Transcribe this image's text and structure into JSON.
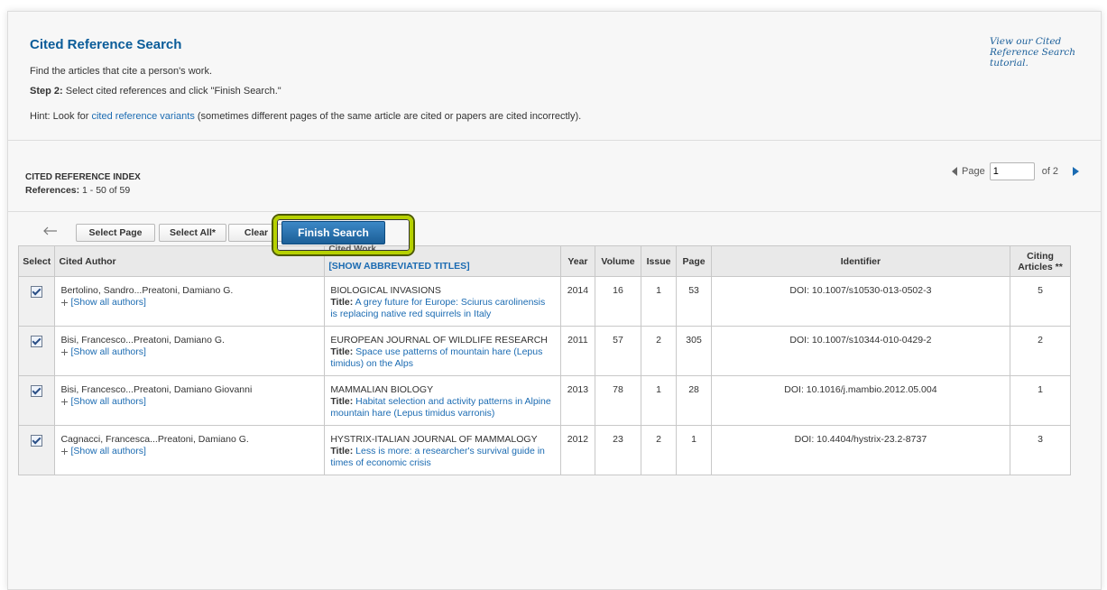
{
  "header": {
    "title": "Cited Reference Search",
    "subtitle": "Find the articles that cite a person's work.",
    "step_label": "Step 2:",
    "step_text": "Select cited references and click \"Finish Search.\"",
    "hint_prefix": "Hint: Look for",
    "hint_link": "cited reference variants",
    "hint_suffix": "(sometimes different pages of the same article are cited or papers are cited incorrectly).",
    "tutorial_link": "View our Cited Reference Search tutorial."
  },
  "index": {
    "title": "CITED REFERENCE INDEX",
    "refs_label": "References:",
    "refs_range": "1 - 50 of 59"
  },
  "pager": {
    "page_label": "Page",
    "page_value": "1",
    "of_label": "of 2"
  },
  "toolbar": {
    "select_page": "Select Page",
    "select_all": "Select All*",
    "clear_all": "Clear All",
    "finish_search": "Finish Search"
  },
  "table": {
    "headers": {
      "select": "Select",
      "cited_author": "Cited Author",
      "cited_work_top": "Cited Work",
      "cited_work_link": "[SHOW ABBREVIATED TITLES]",
      "year": "Year",
      "volume": "Volume",
      "issue": "Issue",
      "page": "Page",
      "identifier": "Identifier",
      "citing": "Citing Articles **"
    },
    "show_authors": "[Show all authors]",
    "title_label": "Title:",
    "rows": [
      {
        "author": "Bertolino, Sandro...Preatoni, Damiano G.",
        "journal": "BIOLOGICAL INVASIONS",
        "title": "A grey future for Europe: Sciurus carolinensis is replacing native red squirrels in Italy",
        "year": "2014",
        "volume": "16",
        "issue": "1",
        "page": "53",
        "identifier": "DOI: 10.1007/s10530-013-0502-3",
        "citing": "5"
      },
      {
        "author": "Bisi, Francesco...Preatoni, Damiano G.",
        "journal": "EUROPEAN JOURNAL OF WILDLIFE RESEARCH",
        "title": "Space use patterns of mountain hare (Lepus timidus) on the Alps",
        "year": "2011",
        "volume": "57",
        "issue": "2",
        "page": "305",
        "identifier": "DOI: 10.1007/s10344-010-0429-2",
        "citing": "2"
      },
      {
        "author": "Bisi, Francesco...Preatoni, Damiano Giovanni",
        "journal": "MAMMALIAN BIOLOGY",
        "title": "Habitat selection and activity patterns in Alpine mountain hare (Lepus timidus varronis)",
        "year": "2013",
        "volume": "78",
        "issue": "1",
        "page": "28",
        "identifier": "DOI: 10.1016/j.mambio.2012.05.004",
        "citing": "1"
      },
      {
        "author": "Cagnacci, Francesca...Preatoni, Damiano G.",
        "journal": "HYSTRIX-ITALIAN JOURNAL OF MAMMALOGY",
        "title": "Less is more: a researcher's survival guide in times of economic crisis",
        "year": "2012",
        "volume": "23",
        "issue": "2",
        "page": "1",
        "identifier": "DOI: 10.4404/hystrix-23.2-8737",
        "citing": "3"
      }
    ]
  },
  "colors": {
    "title_blue": "#0a5c99",
    "link_blue": "#1b6bb2",
    "highlight_yellow": "#b6d100",
    "button_blue": "#1c5f98"
  }
}
